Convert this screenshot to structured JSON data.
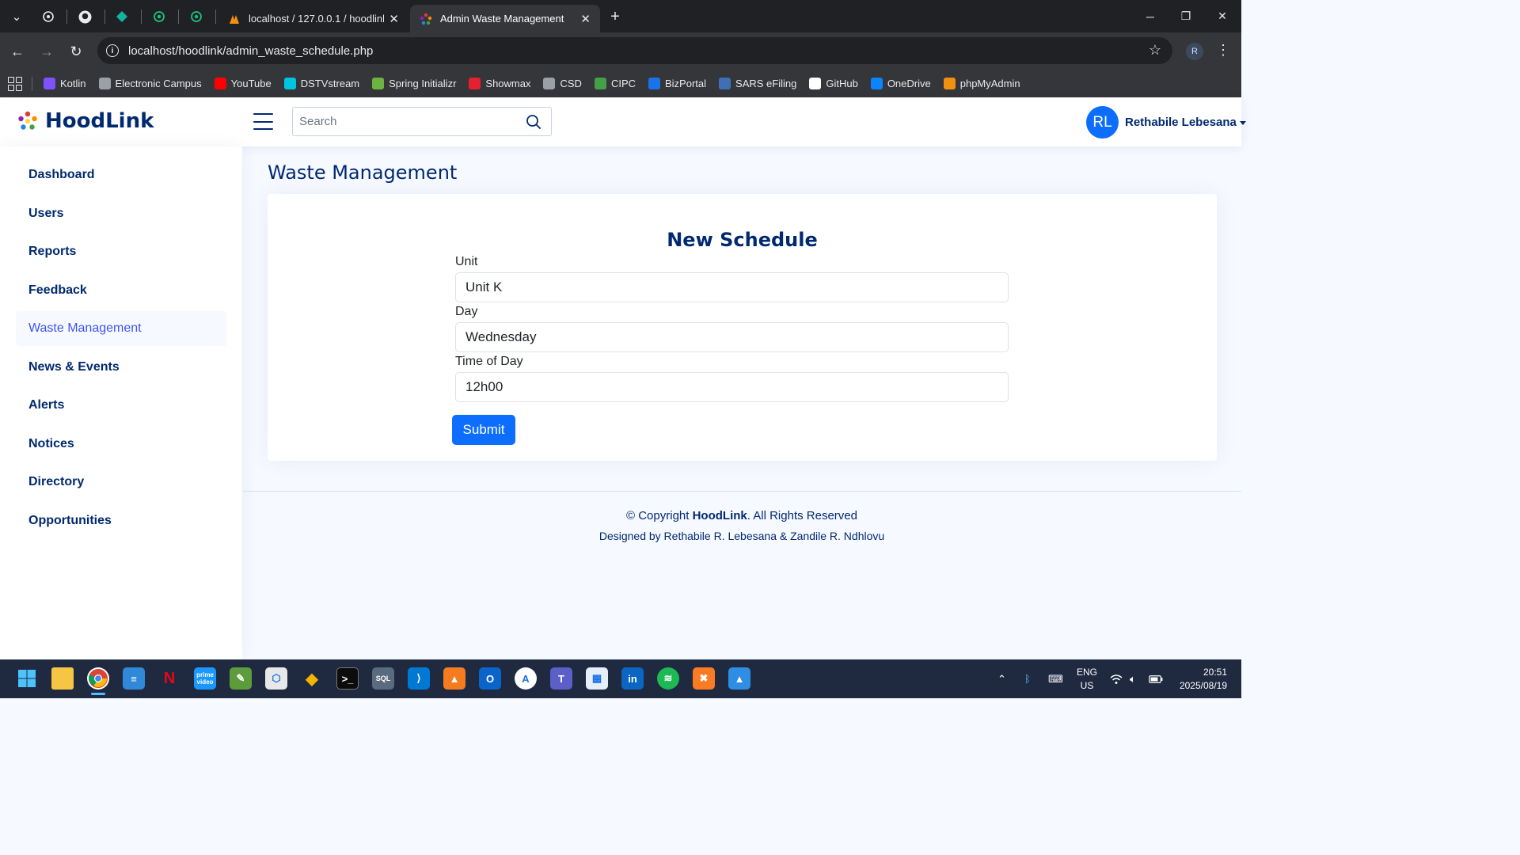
{
  "browser": {
    "tabs": [
      {
        "title": "localhost / 127.0.0.1 / hoodlink",
        "active": false
      },
      {
        "title": "Admin Waste Management",
        "active": true
      }
    ],
    "url": "localhost/hoodlink/admin_waste_schedule.php",
    "profile_initial": "R",
    "bookmarks": [
      {
        "label": "Kotlin",
        "color": "#7f52ff"
      },
      {
        "label": "Electronic Campus",
        "color": "#9aa0a6"
      },
      {
        "label": "YouTube",
        "color": "#ff0000"
      },
      {
        "label": "DSTVstream",
        "color": "#00c4e0"
      },
      {
        "label": "Spring Initializr",
        "color": "#6db33f"
      },
      {
        "label": "Showmax",
        "color": "#e5202f"
      },
      {
        "label": "CSD",
        "color": "#9aa0a6"
      },
      {
        "label": "CIPC",
        "color": "#43a047"
      },
      {
        "label": "BizPortal",
        "color": "#1a73e8"
      },
      {
        "label": "SARS eFiling",
        "color": "#3f6fb5"
      },
      {
        "label": "GitHub",
        "color": "#ffffff"
      },
      {
        "label": "OneDrive",
        "color": "#0a84ff"
      },
      {
        "label": "phpMyAdmin",
        "color": "#f29111"
      }
    ]
  },
  "header": {
    "logo_text": "HoodLink",
    "search_placeholder": "Search",
    "user_initials": "RL",
    "user_name": "Rethabile Lebesana"
  },
  "sidebar": {
    "items": [
      {
        "label": "Dashboard",
        "active": false
      },
      {
        "label": "Users",
        "active": false
      },
      {
        "label": "Reports",
        "active": false
      },
      {
        "label": "Feedback",
        "active": false
      },
      {
        "label": "Waste Management",
        "active": true
      },
      {
        "label": "News & Events",
        "active": false
      },
      {
        "label": "Alerts",
        "active": false
      },
      {
        "label": "Notices",
        "active": false
      },
      {
        "label": "Directory",
        "active": false
      },
      {
        "label": "Opportunities",
        "active": false
      }
    ]
  },
  "main": {
    "page_title": "Waste Management",
    "form": {
      "title": "New Schedule",
      "unit_label": "Unit",
      "unit_value": "Unit K",
      "day_label": "Day",
      "day_value": "Wednesday",
      "time_label": "Time of Day",
      "time_value": "12h00",
      "submit_label": "Submit"
    }
  },
  "footer": {
    "copyright_prefix": "© Copyright",
    "copyright_brand": "HoodLink",
    "copyright_suffix": ". All Rights Reserved",
    "credits": "Designed by Rethabile R. Lebesana & Zandile R. Ndhlovu"
  },
  "taskbar": {
    "lang_line1": "ENG",
    "lang_line2": "US",
    "time": "20:51",
    "date": "2025/08/19"
  },
  "colors": {
    "brand_navy": "#012970",
    "accent_blue": "#0d6efd",
    "active_nav": "#4154f1"
  }
}
